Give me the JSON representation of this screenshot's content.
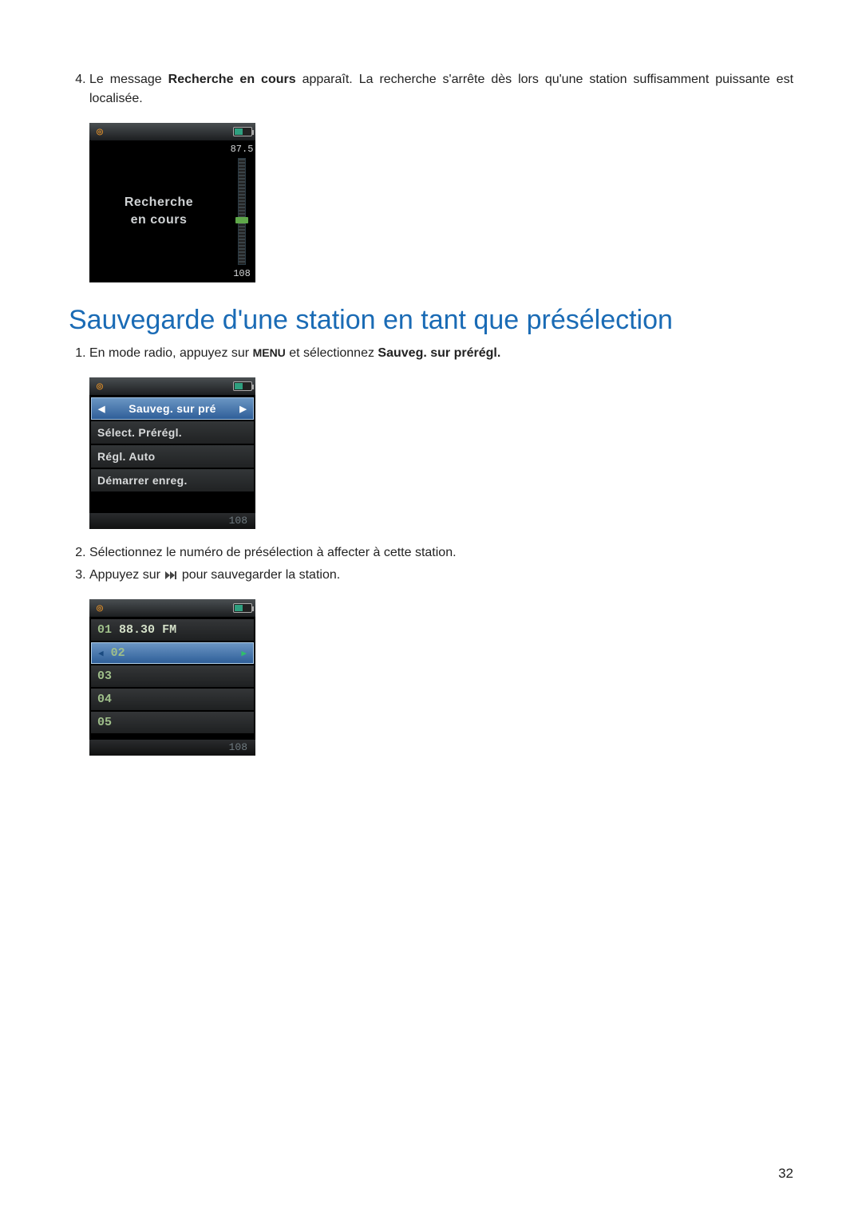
{
  "list_a": {
    "start": 4,
    "items": [
      {
        "pre": "Le message ",
        "bold": "Recherche en cours",
        "post": " apparaît. La recherche s'arrête dès lors qu'une station suffisamment puissante est localisée."
      }
    ]
  },
  "screen1": {
    "line1": "Recherche",
    "line2": "en cours",
    "freq_top": "87.5",
    "freq_bottom": "108",
    "footer": ""
  },
  "heading": "Sauvegarde d'une station en tant que présélection",
  "list_b": {
    "start": 1,
    "items": [
      {
        "pre": "En mode radio, appuyez sur ",
        "kw": "MENU",
        "mid": " et sélectionnez ",
        "bold": "Sauveg. sur prérégl."
      },
      {
        "text": "Sélectionnez le numéro de présélection à affecter à cette station."
      },
      {
        "pre": "Appuyez sur ",
        "icon": "ffwd",
        "post": " pour sauvegarder la station."
      }
    ]
  },
  "screen2": {
    "items": [
      {
        "label": "Sauveg. sur pré",
        "selected": true
      },
      {
        "label": "Sélect. Prérégl.",
        "selected": false
      },
      {
        "label": "Régl. Auto",
        "selected": false
      },
      {
        "label": "Démarrer enreg.",
        "selected": false
      }
    ],
    "footer": "108"
  },
  "screen3": {
    "items": [
      {
        "num": "01",
        "freq": "88.30",
        "band": "FM",
        "selected": false
      },
      {
        "num": "02",
        "freq": "",
        "band": "",
        "selected": true
      },
      {
        "num": "03",
        "freq": "",
        "band": "",
        "selected": false
      },
      {
        "num": "04",
        "freq": "",
        "band": "",
        "selected": false
      },
      {
        "num": "05",
        "freq": "",
        "band": "",
        "selected": false
      }
    ],
    "footer": "108"
  },
  "page_number": "32",
  "icons": {
    "radio_glyph": "◎",
    "tri_left": "◀",
    "tri_right": "▶"
  }
}
